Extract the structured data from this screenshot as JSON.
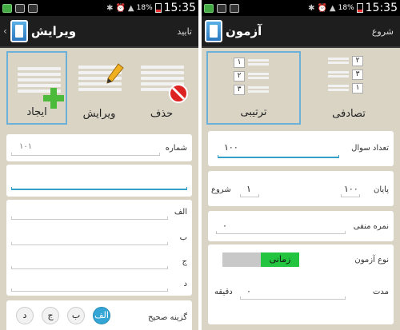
{
  "status_bar": {
    "left": {
      "battery_percent": "18%",
      "time": "15:35"
    },
    "right": {
      "battery_percent": "18%",
      "time": "15:35"
    }
  },
  "left_screen": {
    "action_bar": {
      "title": "ویرایش",
      "action": "تایید"
    },
    "tools": {
      "create": {
        "label": "ایجاد",
        "selected": true,
        "icon": "add-list-icon"
      },
      "edit": {
        "label": "ویرایش",
        "selected": false,
        "icon": "edit-list-icon"
      },
      "delete": {
        "label": "حذف",
        "selected": false,
        "icon": "delete-list-icon"
      }
    },
    "number": {
      "label": "شماره",
      "value": "۱۰۱"
    },
    "question_text": {
      "value": ""
    },
    "options": {
      "a": {
        "label": "الف",
        "value": ""
      },
      "b": {
        "label": "ب",
        "value": ""
      },
      "c": {
        "label": "ج",
        "value": ""
      },
      "d": {
        "label": "د",
        "value": ""
      }
    },
    "correct_answer": {
      "label": "گزینه صحیح",
      "choices": [
        "الف",
        "ب",
        "ج",
        "د"
      ],
      "selected": "الف"
    }
  },
  "right_screen": {
    "action_bar": {
      "title": "آزمون",
      "action": "شروع"
    },
    "modes": {
      "sequential": {
        "label": "ترتیبی",
        "selected": true,
        "numbers": [
          "۱",
          "۲",
          "۳"
        ]
      },
      "random": {
        "label": "تصادفی",
        "selected": false,
        "numbers": [
          "۲",
          "۳",
          "۱"
        ]
      }
    },
    "question_count": {
      "label": "تعداد سوال",
      "value": "۱۰۰"
    },
    "range": {
      "end_label": "پایان",
      "end_value": "۱۰۰",
      "start_label": "شروع",
      "start_value": "۱"
    },
    "negative_score": {
      "label": "نمره منفی",
      "value": "۰"
    },
    "exam_type": {
      "label": "نوع آزمون",
      "toggle_on": "زمانی"
    },
    "duration": {
      "label": "مدت",
      "value": "۰",
      "unit": "دقیقه"
    }
  },
  "colors": {
    "accent": "#33a6d6",
    "toggle_on": "#22c440",
    "background": "#d9d4c4"
  }
}
